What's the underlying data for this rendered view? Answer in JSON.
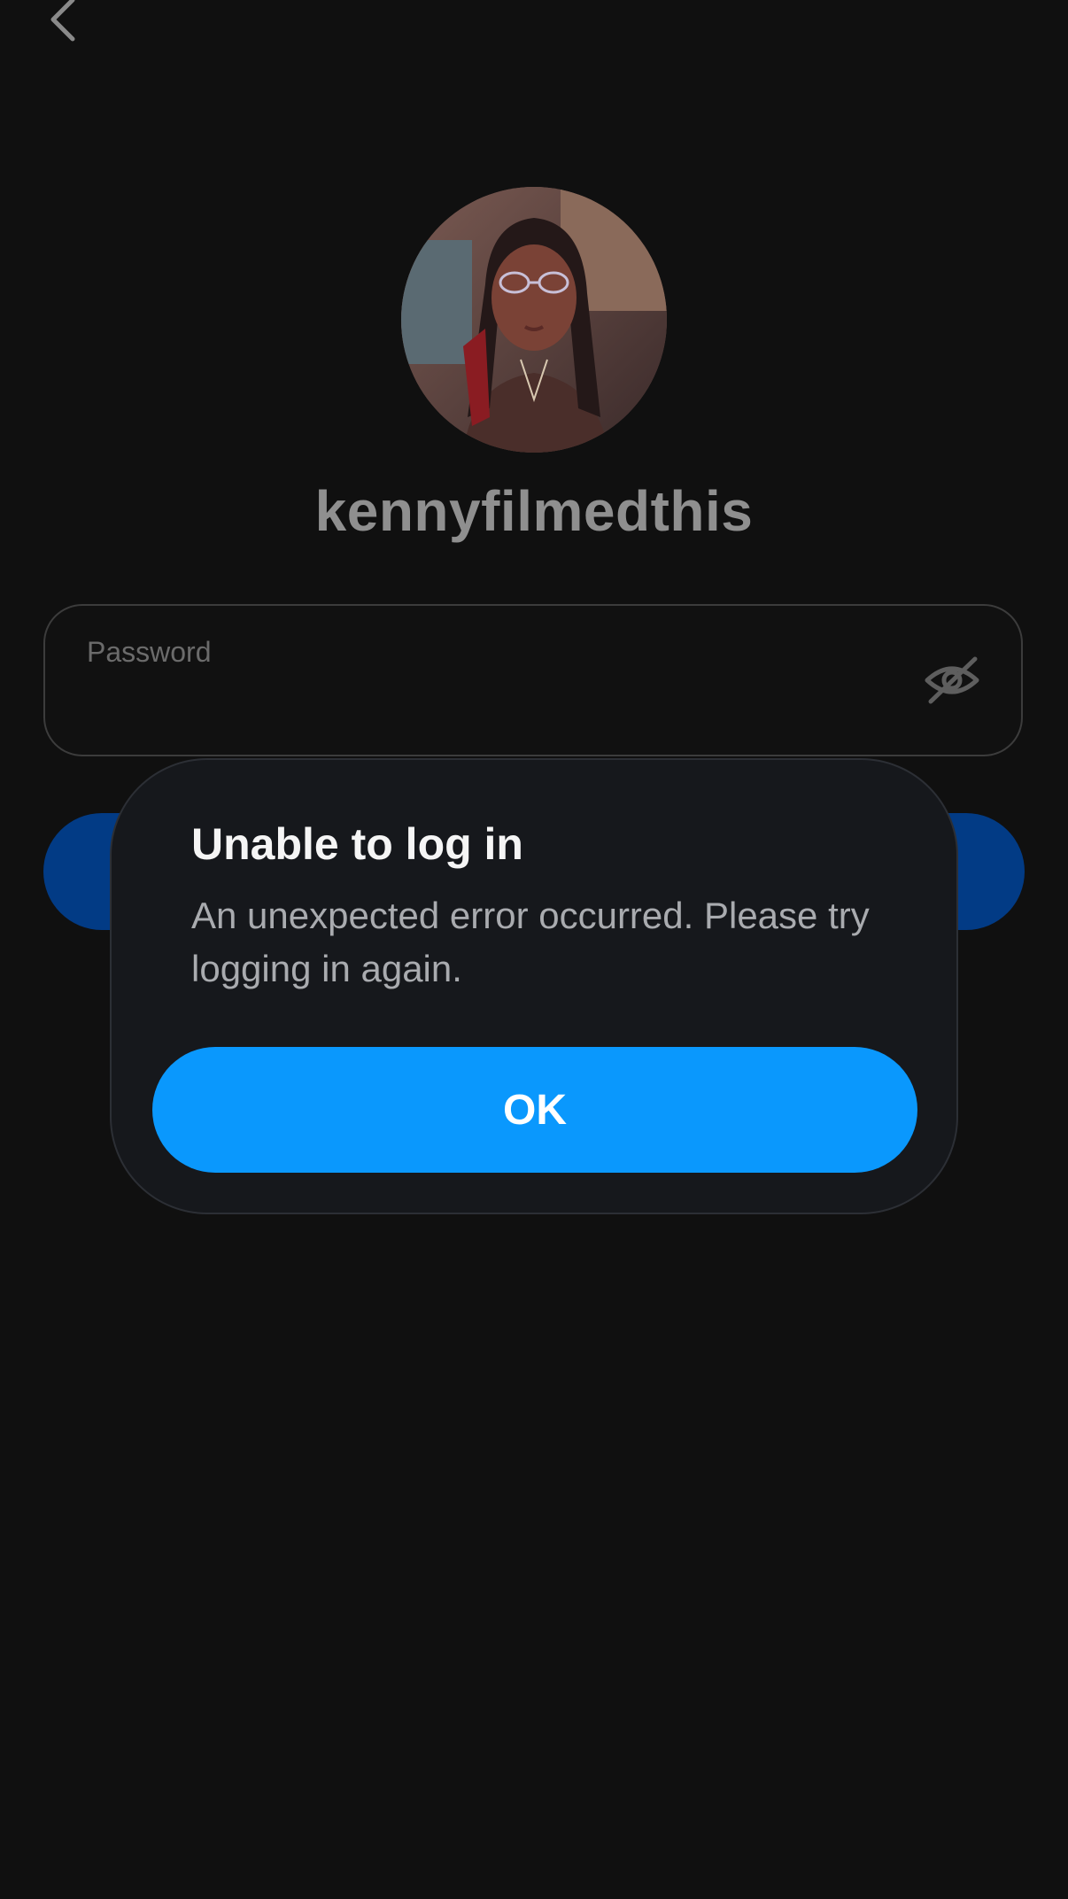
{
  "header": {
    "back_icon": "chevron-left-icon"
  },
  "profile": {
    "username": "kennyfilmedthis",
    "avatar_icon": "profile-photo"
  },
  "password_field": {
    "label": "Password",
    "value": "",
    "visibility_icon": "eye-slash-icon"
  },
  "dialog": {
    "title": "Unable to log in",
    "message": "An unexpected error occurred. Please try logging in again.",
    "ok_label": "OK"
  },
  "colors": {
    "background": "#101010",
    "dialog_background": "#16181c",
    "primary_blue": "#0a98fd",
    "dimmed_blue": "#023b85",
    "username_text": "#8f8f8f"
  }
}
